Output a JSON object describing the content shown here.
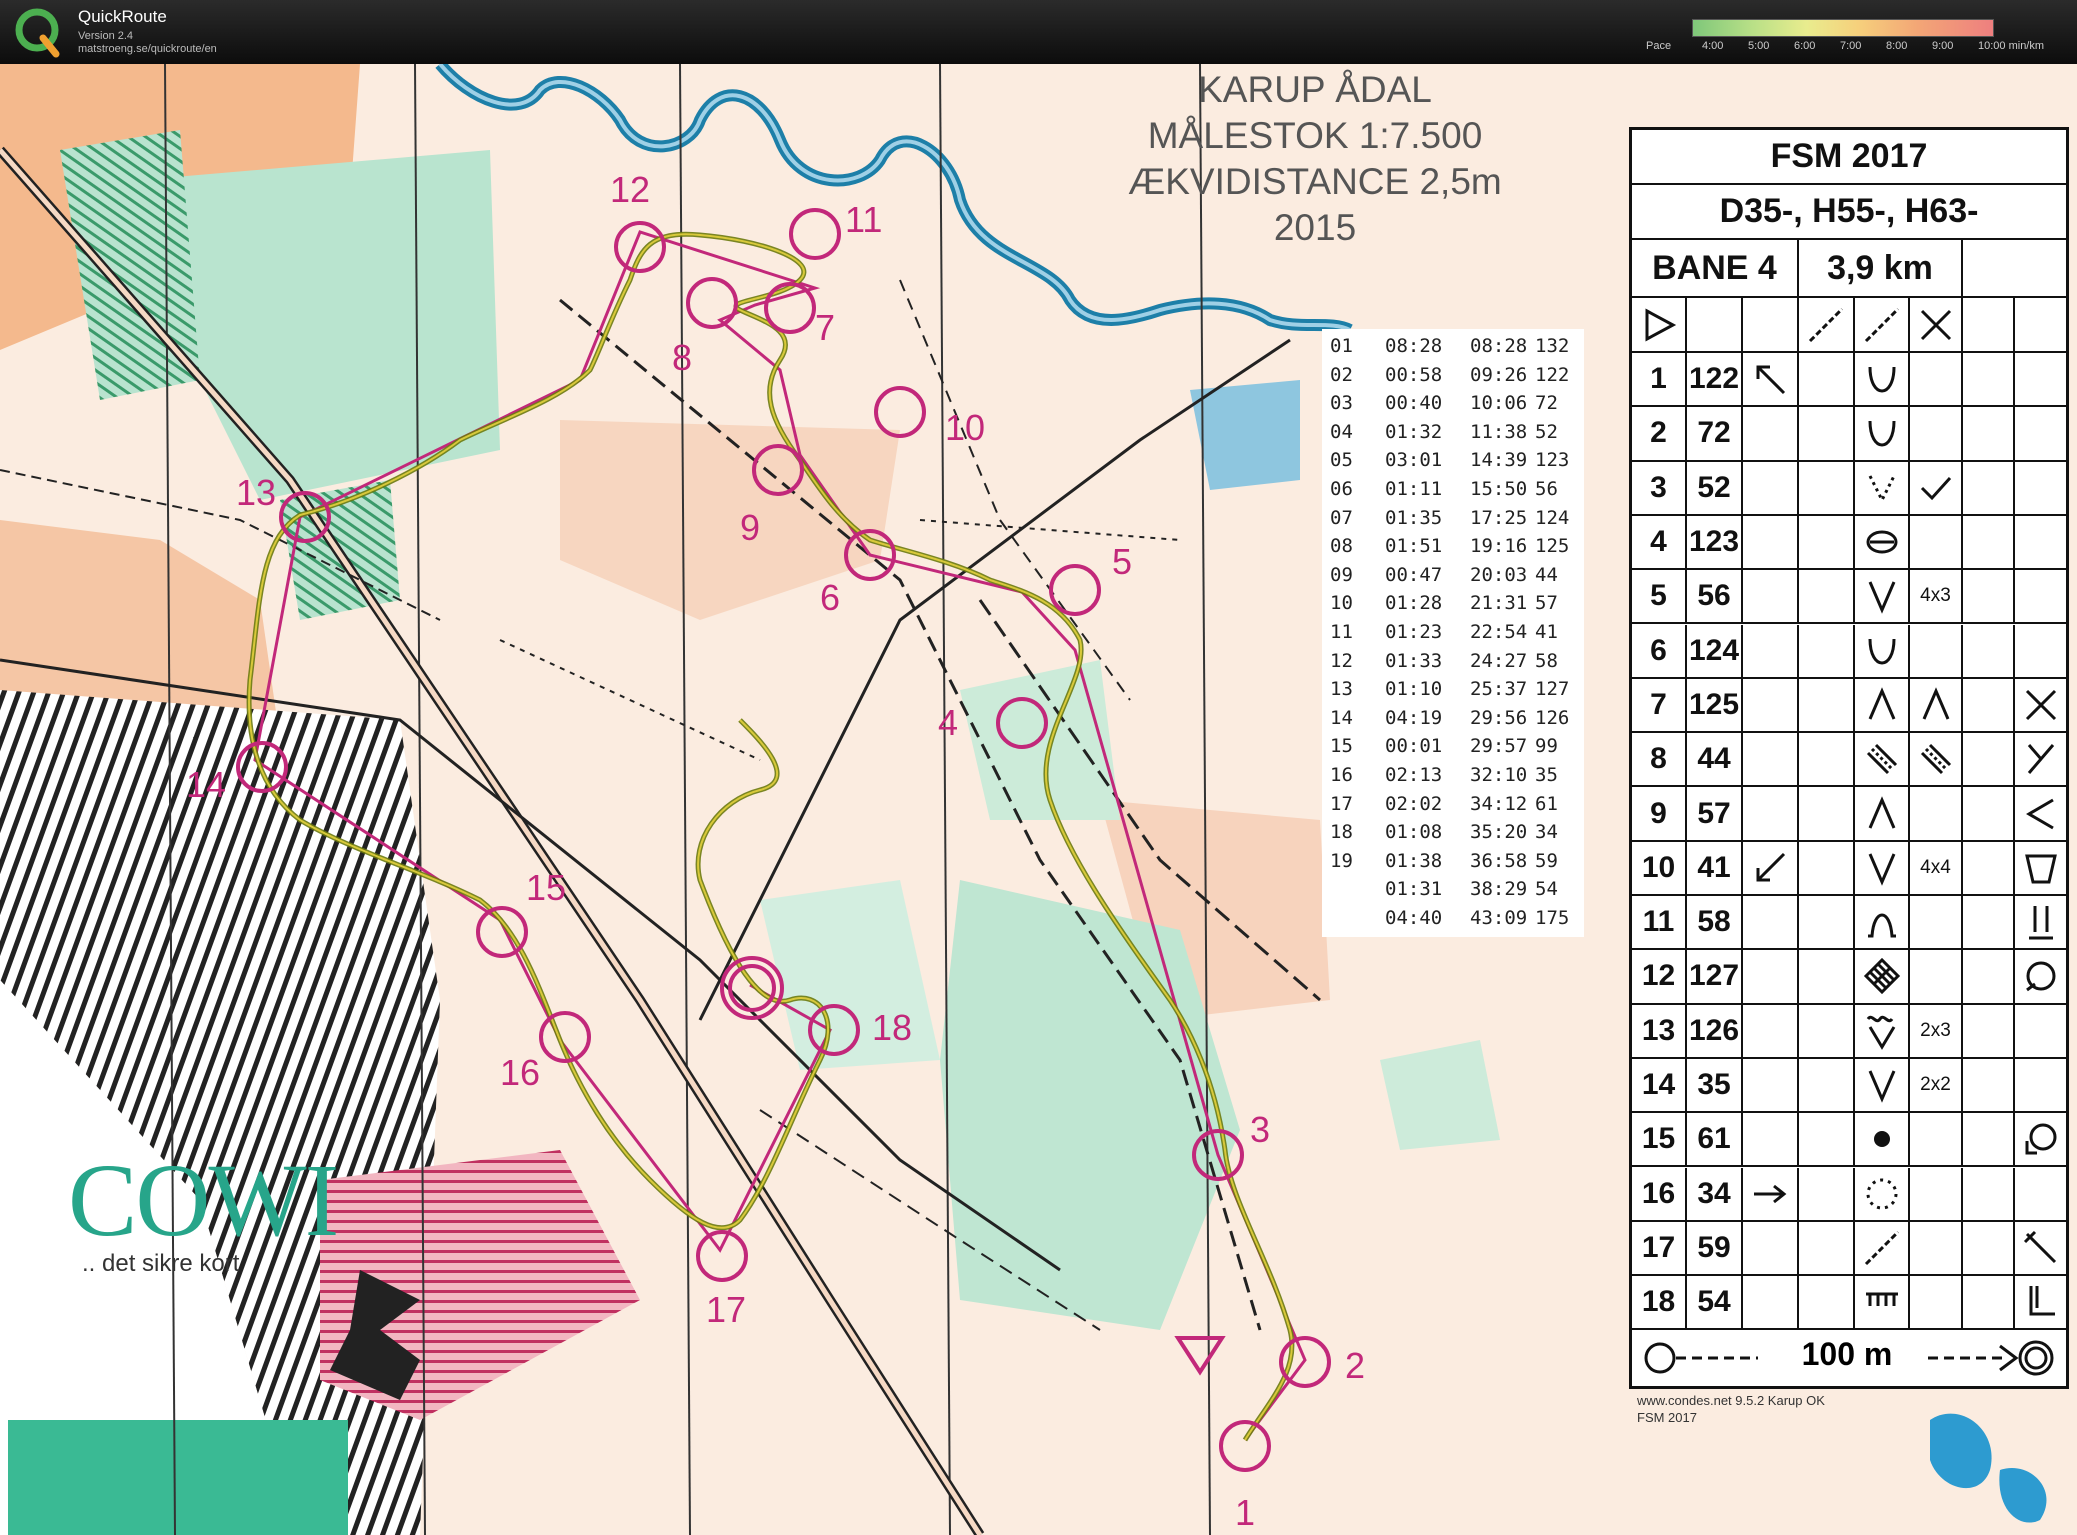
{
  "app": {
    "name": "QuickRoute",
    "version": "Version 2.4",
    "url": "matstroeng.se/quickroute/en",
    "pace_label": "Pace",
    "pace_ticks": [
      "4:00",
      "5:00",
      "6:00",
      "7:00",
      "8:00",
      "9:00",
      "10:00 min/km"
    ]
  },
  "map": {
    "title_lines": [
      "KARUP ÅDAL",
      "MÅLESTOK 1:7.500",
      "ÆKVIDISTANCE 2,5m",
      "2015"
    ],
    "brand": "COWI",
    "brand_tagline": ".. det sikre kort",
    "footer_credit": "www.condes.net 9.5.2 Karup OK",
    "footer_credit2": "FSM 2017",
    "colors": {
      "route": "#8a7a1a",
      "course": "#c2287a",
      "water": "#3b8db5",
      "forest": "#a9dcc4",
      "open": "#f3c7a6"
    },
    "control_numbers": [
      "1",
      "2",
      "3",
      "4",
      "5",
      "6",
      "7",
      "8",
      "9",
      "10",
      "11",
      "12",
      "13",
      "14",
      "15",
      "16",
      "17",
      "18"
    ]
  },
  "splits": [
    {
      "leg": "01",
      "split": "08:28",
      "total": "08:28",
      "code": "132"
    },
    {
      "leg": "02",
      "split": "00:58",
      "total": "09:26",
      "code": "122"
    },
    {
      "leg": "03",
      "split": "00:40",
      "total": "10:06",
      "code": "72"
    },
    {
      "leg": "04",
      "split": "01:32",
      "total": "11:38",
      "code": "52"
    },
    {
      "leg": "05",
      "split": "03:01",
      "total": "14:39",
      "code": "123"
    },
    {
      "leg": "06",
      "split": "01:11",
      "total": "15:50",
      "code": "56"
    },
    {
      "leg": "07",
      "split": "01:35",
      "total": "17:25",
      "code": "124"
    },
    {
      "leg": "08",
      "split": "01:51",
      "total": "19:16",
      "code": "125"
    },
    {
      "leg": "09",
      "split": "00:47",
      "total": "20:03",
      "code": "44"
    },
    {
      "leg": "10",
      "split": "01:28",
      "total": "21:31",
      "code": "57"
    },
    {
      "leg": "11",
      "split": "01:23",
      "total": "22:54",
      "code": "41"
    },
    {
      "leg": "12",
      "split": "01:33",
      "total": "24:27",
      "code": "58"
    },
    {
      "leg": "13",
      "split": "01:10",
      "total": "25:37",
      "code": "127"
    },
    {
      "leg": "14",
      "split": "04:19",
      "total": "29:56",
      "code": "126"
    },
    {
      "leg": "15",
      "split": "00:01",
      "total": "29:57",
      "code": "99"
    },
    {
      "leg": "16",
      "split": "02:13",
      "total": "32:10",
      "code": "35"
    },
    {
      "leg": "17",
      "split": "02:02",
      "total": "34:12",
      "code": "61"
    },
    {
      "leg": "18",
      "split": "01:08",
      "total": "35:20",
      "code": "34"
    },
    {
      "leg": "19",
      "split": "01:38",
      "total": "36:58",
      "code": "59"
    },
    {
      "leg": "",
      "split": "01:31",
      "total": "38:29",
      "code": "54"
    },
    {
      "leg": "",
      "split": "04:40",
      "total": "43:09",
      "code": "175"
    }
  ],
  "description": {
    "event": "FSM 2017",
    "classes": "D35-, H55-, H63-",
    "course": "BANE 4",
    "length": "3,9 km",
    "controls": [
      {
        "n": "1",
        "code": "122",
        "extra": ""
      },
      {
        "n": "2",
        "code": "72",
        "extra": ""
      },
      {
        "n": "3",
        "code": "52",
        "extra": ""
      },
      {
        "n": "4",
        "code": "123",
        "extra": ""
      },
      {
        "n": "5",
        "code": "56",
        "extra": "4x3"
      },
      {
        "n": "6",
        "code": "124",
        "extra": ""
      },
      {
        "n": "7",
        "code": "125",
        "extra": ""
      },
      {
        "n": "8",
        "code": "44",
        "extra": ""
      },
      {
        "n": "9",
        "code": "57",
        "extra": ""
      },
      {
        "n": "10",
        "code": "41",
        "extra": "4x4"
      },
      {
        "n": "11",
        "code": "58",
        "extra": ""
      },
      {
        "n": "12",
        "code": "127",
        "extra": ""
      },
      {
        "n": "13",
        "code": "126",
        "extra": "2x3"
      },
      {
        "n": "14",
        "code": "35",
        "extra": "2x2"
      },
      {
        "n": "15",
        "code": "61",
        "extra": ""
      },
      {
        "n": "16",
        "code": "34",
        "extra": ""
      },
      {
        "n": "17",
        "code": "59",
        "extra": ""
      },
      {
        "n": "18",
        "code": "54",
        "extra": ""
      }
    ],
    "finish": "100 m"
  }
}
